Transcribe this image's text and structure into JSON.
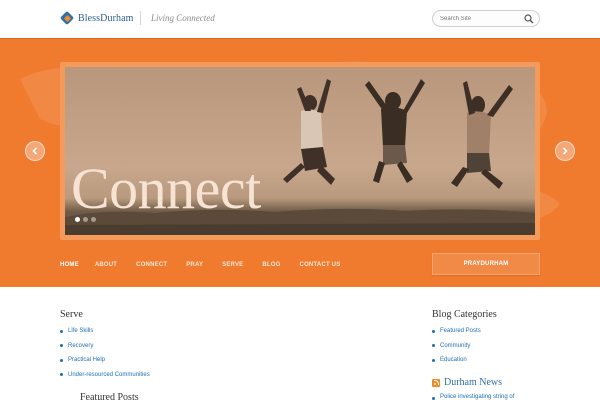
{
  "header": {
    "logo_text": "BlessDurham",
    "tagline": "Living Connected",
    "search_placeholder": "Search Site"
  },
  "slider": {
    "caption": "Connect",
    "slide_count": 3,
    "active_slide": 1
  },
  "nav": {
    "items": [
      {
        "label": "HOME",
        "current": true
      },
      {
        "label": "ABOUT"
      },
      {
        "label": "CONNECT"
      },
      {
        "label": "PRAY"
      },
      {
        "label": "SERVE"
      },
      {
        "label": "BLOG"
      },
      {
        "label": "CONTACT US"
      }
    ],
    "pray_button": "PRAYDURHAM"
  },
  "serve": {
    "title": "Serve",
    "items": [
      "Life Skills",
      "Recovery",
      "Practical Help",
      "Under-resourced Communities"
    ]
  },
  "featured": {
    "title": "Featured Posts"
  },
  "blog_categories": {
    "title": "Blog Categories",
    "items": [
      "Featured Posts",
      "Community",
      "Education"
    ]
  },
  "news": {
    "title": "Durham News",
    "first_item": "Police investigating string of"
  },
  "colors": {
    "brand_orange": "#f07a2e",
    "link_blue": "#1e6fb0",
    "logo_blue": "#2f5f8f"
  }
}
